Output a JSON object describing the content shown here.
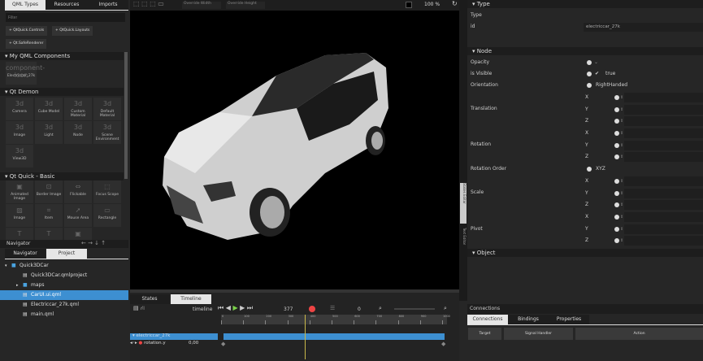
{
  "library": {
    "tabs": [
      "QML Types",
      "Resources",
      "Imports"
    ],
    "filter_placeholder": "Filter",
    "import_buttons": [
      "QtQuick.Controls",
      "QtQuick.Layouts",
      "Qt.SafeRenderer"
    ],
    "sections": [
      {
        "title": "My QML Components",
        "items": [
          {
            "label": "Electriccar_27k",
            "icon": "component-icon"
          }
        ]
      },
      {
        "title": "Qt Demon",
        "items": [
          {
            "label": "Camera",
            "icon": "3d"
          },
          {
            "label": "Cube Model",
            "icon": "3d"
          },
          {
            "label": "Custom Material",
            "icon": "3d"
          },
          {
            "label": "Default Material",
            "icon": "3d"
          },
          {
            "label": "Image",
            "icon": "3d"
          },
          {
            "label": "Light",
            "icon": "3d"
          },
          {
            "label": "Node",
            "icon": "3d"
          },
          {
            "label": "Scene Environment",
            "icon": "3d"
          },
          {
            "label": "View3D",
            "icon": "3d"
          }
        ]
      },
      {
        "title": "Qt Quick - Basic",
        "items": [
          {
            "label": "Animated Image",
            "icon": "▣"
          },
          {
            "label": "Border Image",
            "icon": "⊡"
          },
          {
            "label": "Flickable",
            "icon": "⇔"
          },
          {
            "label": "Focus Scope",
            "icon": "⬚"
          },
          {
            "label": "Image",
            "icon": "▨"
          },
          {
            "label": "Item",
            "icon": "⌗"
          },
          {
            "label": "Mouse Area",
            "icon": "➚"
          },
          {
            "label": "Rectangle",
            "icon": "▭"
          },
          {
            "label": "",
            "icon": "T"
          },
          {
            "label": "",
            "icon": "T"
          },
          {
            "label": "",
            "icon": "▣"
          }
        ]
      }
    ]
  },
  "navigator": {
    "dropdown": "Navigator",
    "tabs": [
      "Navigator",
      "Project"
    ],
    "tree": [
      {
        "label": "Quick3DCar",
        "level": 0,
        "type": "folder",
        "expanded": true
      },
      {
        "label": "Quick3DCar.qmlproject",
        "level": 1,
        "type": "file"
      },
      {
        "label": "maps",
        "level": 1,
        "type": "folder",
        "expanded": false
      },
      {
        "label": "CarUI.ui.qml",
        "level": 1,
        "type": "file",
        "selected": true
      },
      {
        "label": "Electriccar_27k.qml",
        "level": 1,
        "type": "file"
      },
      {
        "label": "main.qml",
        "level": 1,
        "type": "file"
      }
    ]
  },
  "toolbar": {
    "override_width": "Override Width",
    "override_height": "Override Height",
    "zoom": "100 %"
  },
  "side_tabs": [
    "States Editor",
    "Text Editor"
  ],
  "timeline": {
    "tabs": [
      "States",
      "Timeline"
    ],
    "label": "timeline",
    "current_frame": "377",
    "end_value": "0",
    "ticks": [
      "0",
      "100",
      "200",
      "300",
      "400",
      "500",
      "600",
      "700",
      "800",
      "900",
      "1000"
    ],
    "playhead_frame": 377,
    "target": "electriccar_27k",
    "property": "rotation.y",
    "property_value": "0,00"
  },
  "properties": {
    "type_section": "Type",
    "type_label": "Type",
    "id_label": "id",
    "id_value": "electriccar_27k",
    "node_section": "Node",
    "opacity_label": "Opacity",
    "visible_label": "is Visible",
    "visible_value": "true",
    "orientation_label": "Orientation",
    "orientation_value": "RightHanded",
    "translation_label": "Translation",
    "rotation_label": "Rotation",
    "rotation_order_label": "Rotation Order",
    "rotation_order_value": "XYZ",
    "scale_label": "Scale",
    "pivot_label": "Pivot",
    "axes": [
      "X",
      "Y",
      "Z"
    ],
    "object_section": "Object"
  },
  "connections": {
    "dropdown": "Connections",
    "tabs": [
      "Connections",
      "Bindings",
      "Properties"
    ],
    "columns": [
      "Target",
      "Signal Handler",
      "Action"
    ]
  }
}
